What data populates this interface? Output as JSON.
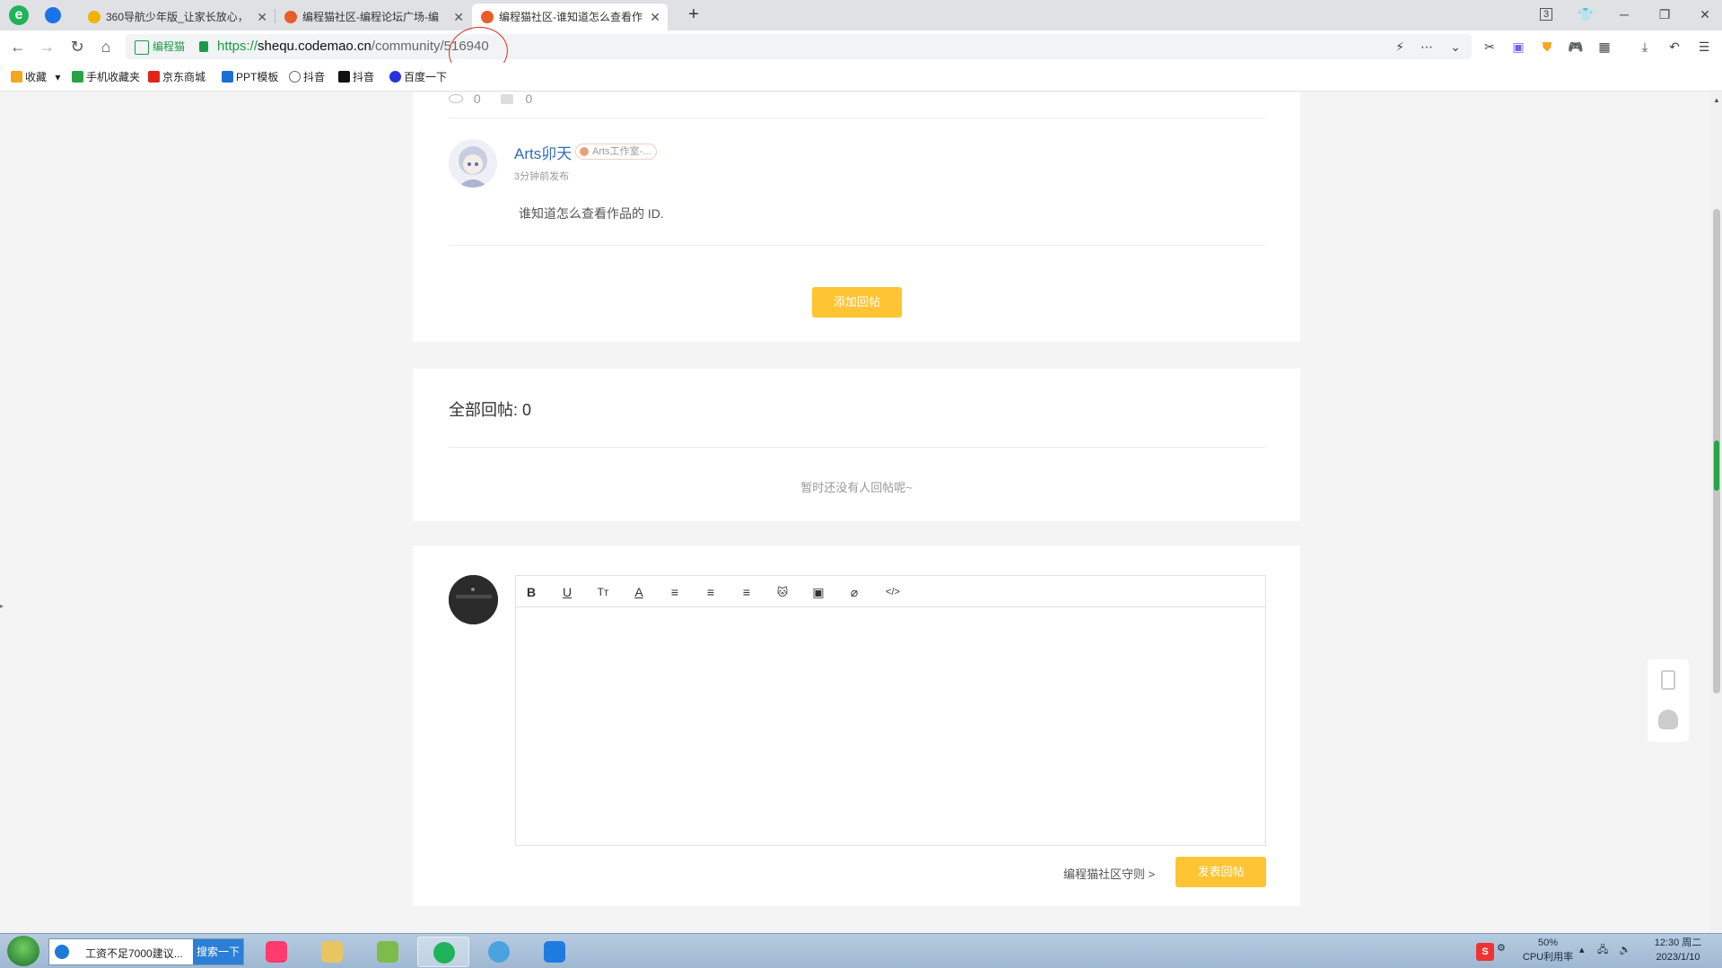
{
  "browser": {
    "tabs": [
      {
        "title": "360导航少年版_让家长放心，",
        "favicon_color": "#f0b400"
      },
      {
        "title": "编程猫社区-编程论坛广场-编",
        "favicon_color": "#e85d2a"
      },
      {
        "title": "编程猫社区-谁知道怎么查看作",
        "favicon_color": "#e85d2a"
      }
    ],
    "new_tab_label": "+",
    "tab_count": "3",
    "address": {
      "site_badge": "编程猫",
      "scheme": "https://",
      "host": "shequ.codemao.cn",
      "path": "/community/516940"
    },
    "bookmarks": [
      {
        "label": "收藏",
        "icon_color": "#f5a623"
      },
      {
        "label": "手机收藏夹",
        "icon_color": "#2ba245"
      },
      {
        "label": "京东商城",
        "icon_color": "#e1251b"
      },
      {
        "label": "PPT模板",
        "icon_color": "#1a6fd6"
      },
      {
        "label": "抖音",
        "icon_color": "#666666"
      },
      {
        "label": "抖音",
        "icon_color": "#111111"
      },
      {
        "label": "百度一下",
        "icon_color": "#2932e1"
      }
    ]
  },
  "post": {
    "views": "0",
    "comments": "0",
    "reply": {
      "author": "Arts卯天",
      "tag": "Arts工作室-...",
      "time": "3分钟前发布",
      "body": "谁知道怎么查看作品的 ID."
    },
    "add_reply_button": "添加回帖"
  },
  "replies": {
    "title": "全部回帖: 0",
    "empty_text": "暂时还没有人回帖呢~"
  },
  "editor": {
    "tools": [
      {
        "name": "bold-tool",
        "glyph": "B"
      },
      {
        "name": "underline-tool",
        "glyph": "U"
      },
      {
        "name": "font-size-tool",
        "glyph": "Tт"
      },
      {
        "name": "font-color-tool",
        "glyph": "A"
      },
      {
        "name": "align-left-tool",
        "glyph": "≡"
      },
      {
        "name": "align-center-tool",
        "glyph": "≡"
      },
      {
        "name": "align-right-tool",
        "glyph": "≡"
      },
      {
        "name": "emoji-cat-tool",
        "glyph": "🐱"
      },
      {
        "name": "image-tool",
        "glyph": "▣"
      },
      {
        "name": "attachment-tool",
        "glyph": "⌀"
      },
      {
        "name": "code-tool",
        "glyph": "</>"
      }
    ],
    "rules_link": "编程猫社区守则 >",
    "submit_button": "发表回帖"
  },
  "taskbar": {
    "search_query": "工资不足7000建议...",
    "search_button": "搜索一下",
    "cpu_percent": "50%",
    "cpu_label": "CPU利用率",
    "time": "12:30 周二",
    "date": "2023/1/10"
  },
  "colors": {
    "accent_yellow": "#fec433",
    "link_blue": "#2f6db5",
    "secure_green": "#1a9c47",
    "annotation_red": "#d9302c"
  }
}
